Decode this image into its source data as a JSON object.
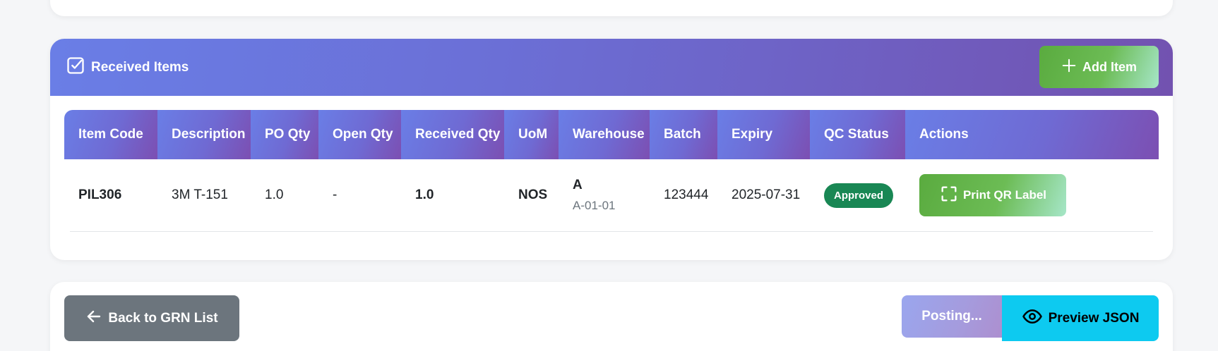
{
  "section": {
    "title": "Received Items",
    "add_label": "Add Item"
  },
  "table": {
    "headers": [
      "Item Code",
      "Description",
      "PO Qty",
      "Open Qty",
      "Received Qty",
      "UoM",
      "Warehouse",
      "Batch",
      "Expiry",
      "QC Status",
      "Actions"
    ],
    "rows": [
      {
        "item_code": "PIL306",
        "description": "3M T-151",
        "po_qty": "1.0",
        "open_qty": "-",
        "received_qty": "1.0",
        "uom": "NOS",
        "warehouse": "A",
        "location": "A-01-01",
        "batch": "123444",
        "expiry": "2025-07-31",
        "qc_status": "Approved",
        "action_label": "Print QR Label"
      }
    ]
  },
  "footer": {
    "back_label": "Back to GRN List",
    "posting_label": "Posting...",
    "preview_label": "Preview JSON"
  },
  "colors": {
    "header_gradient_start": "#6a7ee6",
    "header_gradient_end": "#7252b0",
    "success": "#198754",
    "info": "#0dcaf0",
    "secondary": "#6c757d"
  },
  "icons": {
    "title": "check-square-icon",
    "add": "plus-icon",
    "qr": "scan-icon",
    "back": "arrow-left-icon",
    "preview": "eye-icon"
  }
}
